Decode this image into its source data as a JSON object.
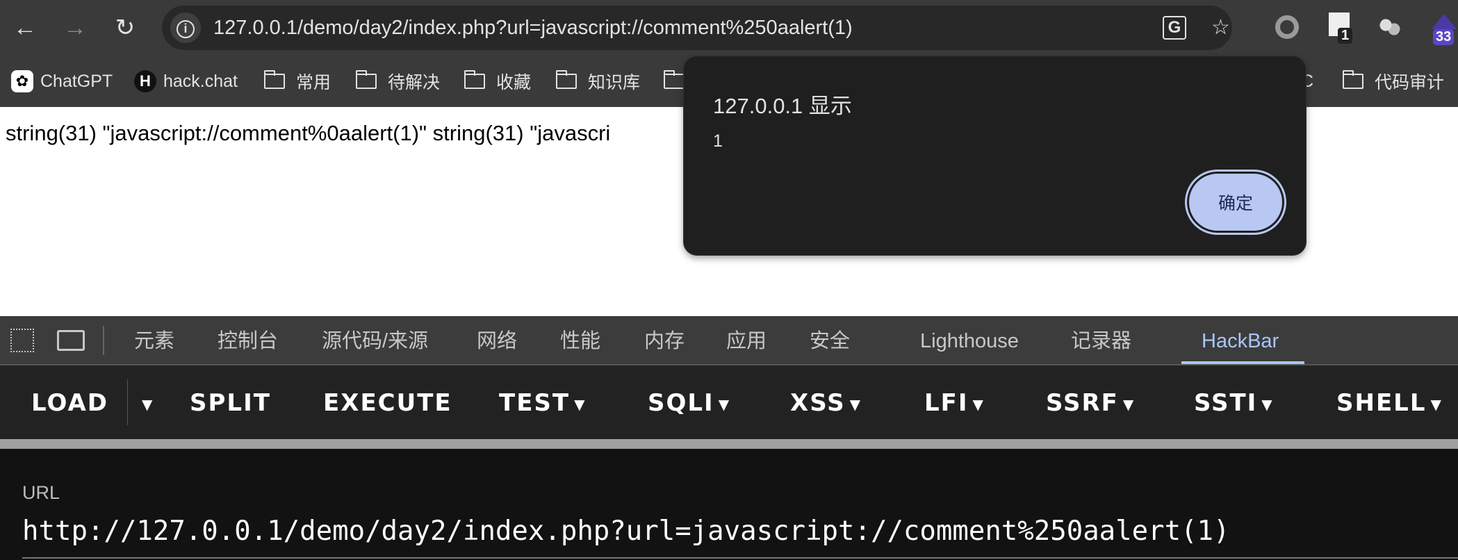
{
  "browser": {
    "address": "127.0.0.1/demo/day2/index.php?url=javascript://comment%250aalert(1)",
    "extension_badges": [
      "1",
      "33"
    ],
    "icons": [
      "back-icon",
      "forward-icon",
      "reload-icon",
      "info-icon",
      "translate-icon",
      "star-icon"
    ]
  },
  "bookmarks": [
    {
      "label": "ChatGPT",
      "type": "site"
    },
    {
      "label": "hack.chat",
      "type": "site"
    },
    {
      "label": "常用",
      "type": "folder"
    },
    {
      "label": "待解决",
      "type": "folder"
    },
    {
      "label": "收藏",
      "type": "folder"
    },
    {
      "label": "知识库",
      "type": "folder"
    },
    {
      "label": "C",
      "type": "partial"
    },
    {
      "label": "代码审计",
      "type": "folder"
    }
  ],
  "page": {
    "output": "string(31) \"javascript://comment%0aalert(1)\" string(31) \"javascri"
  },
  "dialog": {
    "title": "127.0.0.1 显示",
    "message": "1",
    "ok_label": "确定"
  },
  "devtools": {
    "tabs": [
      "元素",
      "控制台",
      "源代码/来源",
      "网络",
      "性能",
      "内存",
      "应用",
      "安全",
      "Lighthouse",
      "记录器",
      "HackBar"
    ],
    "active_tab": "HackBar",
    "accent": "#a8c7fa"
  },
  "hackbar": {
    "buttons": [
      "LOAD",
      "SPLIT",
      "EXECUTE",
      "TEST",
      "SQLI",
      "XSS",
      "LFI",
      "SSRF",
      "SSTI",
      "SHELL"
    ],
    "url_label": "URL",
    "url_value": "http://127.0.0.1/demo/day2/index.php?url=javascript://comment%250aalert(1)"
  }
}
